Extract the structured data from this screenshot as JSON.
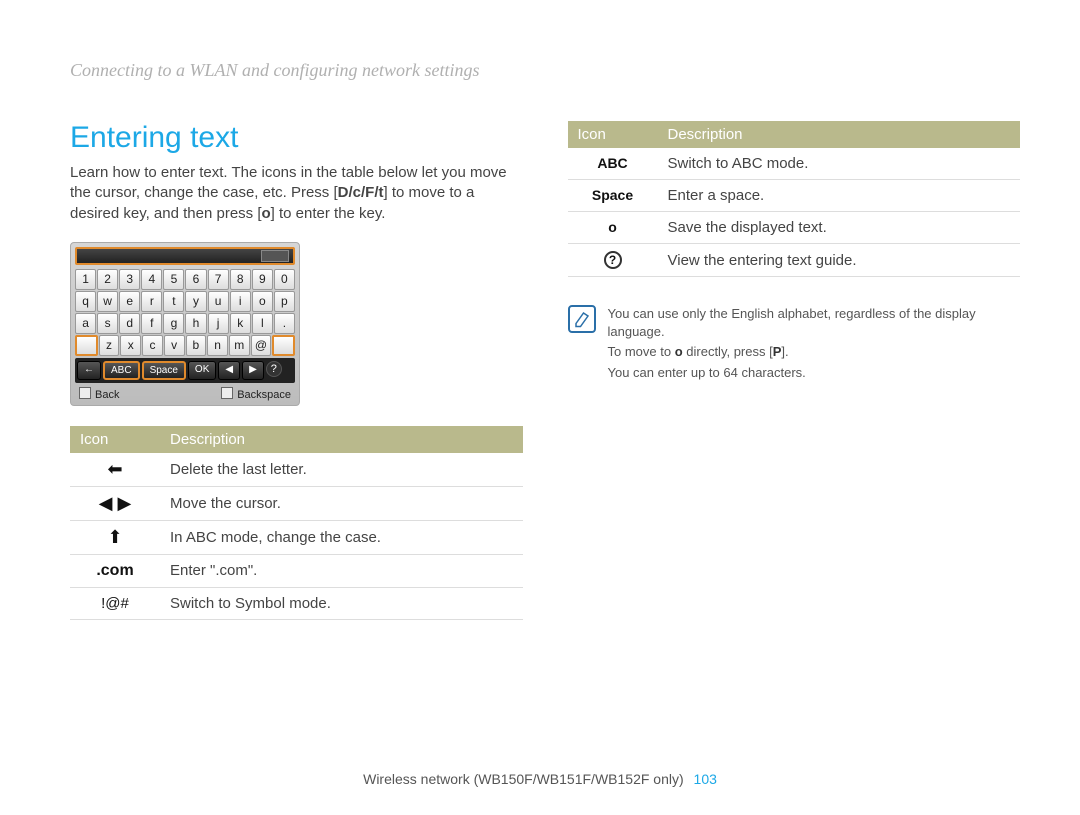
{
  "breadcrumb": "Connecting to a WLAN and configuring network settings",
  "section_title": "Entering text",
  "intro_parts": {
    "p1": "Learn how to enter text. The icons in the table below let you move the cursor, change the case, etc. Press [",
    "keys": "D/c/F/t",
    "p2": "] to move to a desired key, and then press [",
    "okey": "o",
    "p3": "] to enter the key."
  },
  "keyboard": {
    "rows": [
      [
        "1",
        "2",
        "3",
        "4",
        "5",
        "6",
        "7",
        "8",
        "9",
        "0"
      ],
      [
        "q",
        "w",
        "e",
        "r",
        "t",
        "y",
        "u",
        "i",
        "o",
        "p"
      ],
      [
        "a",
        "s",
        "d",
        "f",
        "g",
        "h",
        "j",
        "k",
        "l",
        "."
      ],
      [
        "",
        "z",
        "x",
        "c",
        "v",
        "b",
        "n",
        "m",
        "@",
        ""
      ]
    ],
    "bottom": [
      "←",
      "ABC",
      "Space",
      "OK",
      "◀",
      "▶",
      "?"
    ],
    "foot_left": "Back",
    "foot_right": "Backspace"
  },
  "table_headers": {
    "icon": "Icon",
    "desc": "Description"
  },
  "left_table": [
    {
      "icon_type": "arrow-left-thick",
      "glyph": "⬅",
      "desc": "Delete the last letter."
    },
    {
      "icon_type": "arrows-lr",
      "glyph": "◀ ▶",
      "desc": "Move the cursor."
    },
    {
      "icon_type": "arrow-up-thick",
      "glyph": "⬆",
      "desc": "In ABC mode, change the case."
    },
    {
      "icon_type": "text",
      "glyph": ".com",
      "desc": "Enter \".com\"."
    },
    {
      "icon_type": "text",
      "glyph": "!@#",
      "desc": "Switch to Symbol mode."
    }
  ],
  "right_table": [
    {
      "icon_type": "text-bold",
      "glyph": "ABC",
      "desc": "Switch to ABC mode."
    },
    {
      "icon_type": "text-bold",
      "glyph": "Space",
      "desc": "Enter a space."
    },
    {
      "icon_type": "text-bold",
      "glyph": "o",
      "desc": "Save the displayed text."
    },
    {
      "icon_type": "qmark",
      "glyph": "?",
      "desc": "View the entering text guide."
    }
  ],
  "note": {
    "lines": [
      {
        "t": "You can use only the English alphabet, regardless of the display language."
      },
      {
        "pre": "To move to ",
        "b1": "o",
        "mid": " directly, press [",
        "b2": "P",
        "post": "]."
      },
      {
        "t": "You can enter up to 64 characters."
      }
    ]
  },
  "footer": {
    "text": "Wireless network (WB150F/WB151F/WB152F only)",
    "page": "103"
  }
}
